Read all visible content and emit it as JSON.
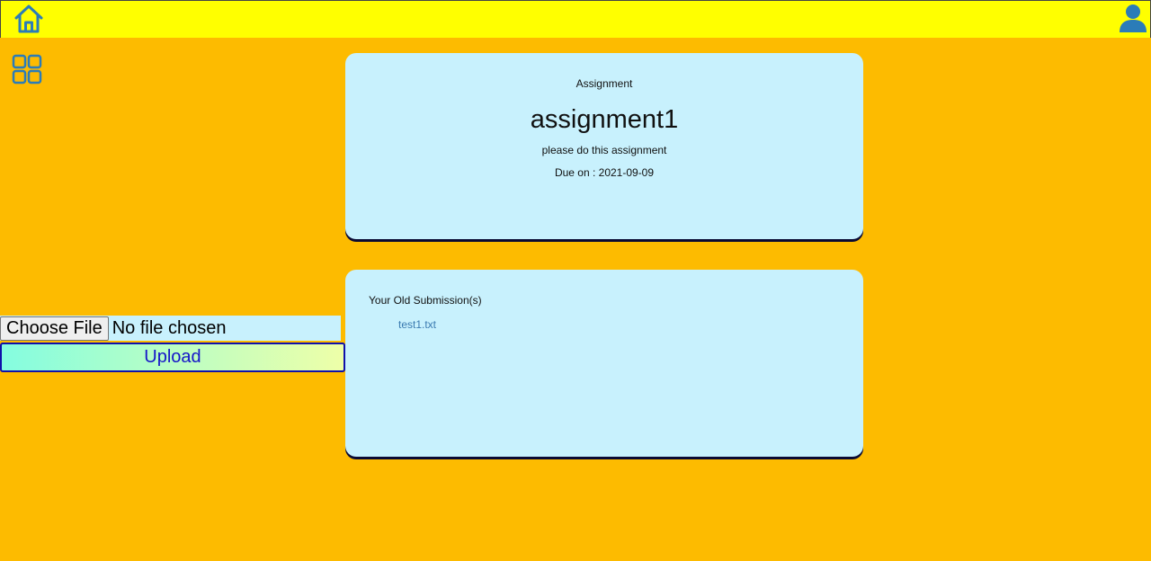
{
  "header": {
    "home_icon": "home-icon",
    "user_icon": "user-icon",
    "accent_color": "#ffff00"
  },
  "sidebar": {
    "menu_icon": "grid-icon"
  },
  "assignment": {
    "label": "Assignment",
    "title": "assignment1",
    "description": "please do this assignment",
    "due": "Due on : 2021-09-09"
  },
  "submissions": {
    "label": "Your Old Submission(s)",
    "items": [
      {
        "name": "test1.txt"
      }
    ]
  },
  "upload": {
    "choose_label": "Choose File",
    "file_status": "No file chosen",
    "upload_label": "Upload"
  },
  "colors": {
    "background": "#fdbb00",
    "card": "#c8f1fd",
    "icon": "#2b7cb8",
    "link": "#3a7ab0"
  }
}
